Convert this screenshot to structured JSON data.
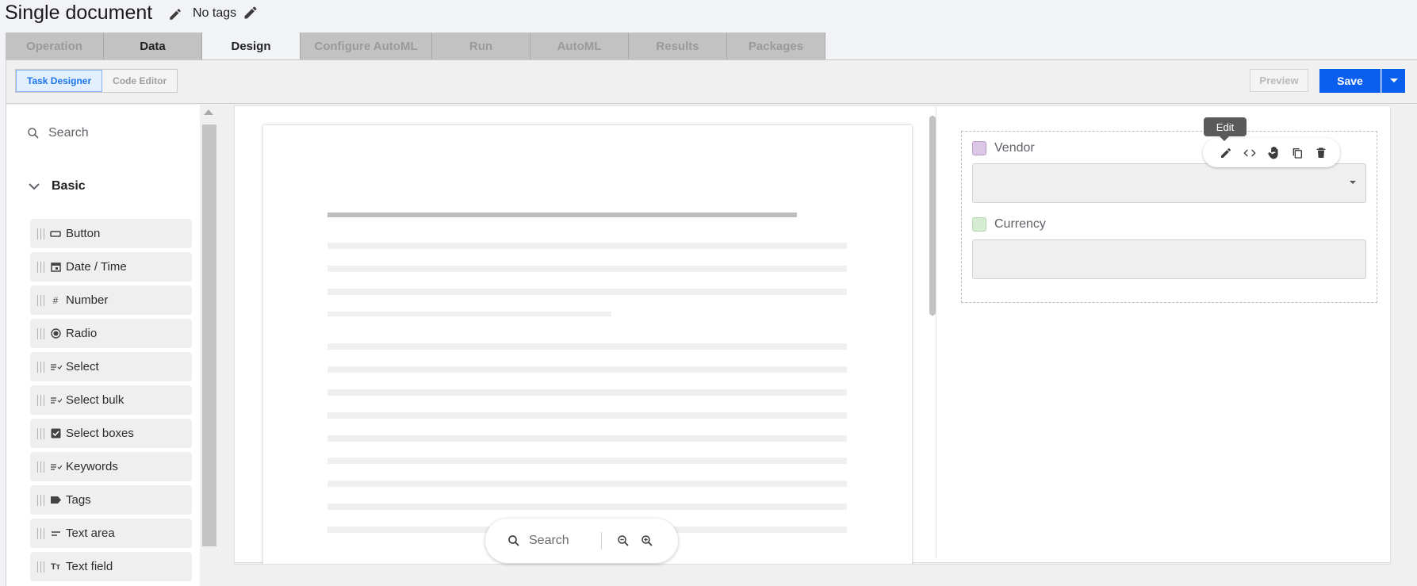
{
  "header": {
    "title": "Single document",
    "tags_label": "No tags"
  },
  "tabs": [
    {
      "label": "Operation"
    },
    {
      "label": "Data"
    },
    {
      "label": "Design"
    },
    {
      "label": "Configure AutoML"
    },
    {
      "label": "Run"
    },
    {
      "label": "AutoML"
    },
    {
      "label": "Results"
    },
    {
      "label": "Packages"
    }
  ],
  "toolbar": {
    "task_designer": "Task Designer",
    "code_editor": "Code Editor",
    "preview": "Preview",
    "save": "Save"
  },
  "sidebar": {
    "search_placeholder": "Search",
    "group": "Basic",
    "items": [
      {
        "label": "Button",
        "icon": "button-icon"
      },
      {
        "label": "Date / Time",
        "icon": "calendar-icon"
      },
      {
        "label": "Number",
        "icon": "hash-icon"
      },
      {
        "label": "Radio",
        "icon": "radio-icon"
      },
      {
        "label": "Select",
        "icon": "select-icon"
      },
      {
        "label": "Select bulk",
        "icon": "select-icon"
      },
      {
        "label": "Select boxes",
        "icon": "checkbox-icon"
      },
      {
        "label": "Keywords",
        "icon": "select-icon"
      },
      {
        "label": "Tags",
        "icon": "tag-icon"
      },
      {
        "label": "Text area",
        "icon": "textarea-icon"
      },
      {
        "label": "Text field",
        "icon": "textfield-icon"
      }
    ]
  },
  "form": {
    "tooltip": "Edit",
    "fields": [
      {
        "label": "Vendor",
        "color": "#dcc6e6"
      },
      {
        "label": "Currency",
        "color": "#d6ecd0"
      }
    ]
  },
  "doc_search": {
    "placeholder": "Search"
  }
}
